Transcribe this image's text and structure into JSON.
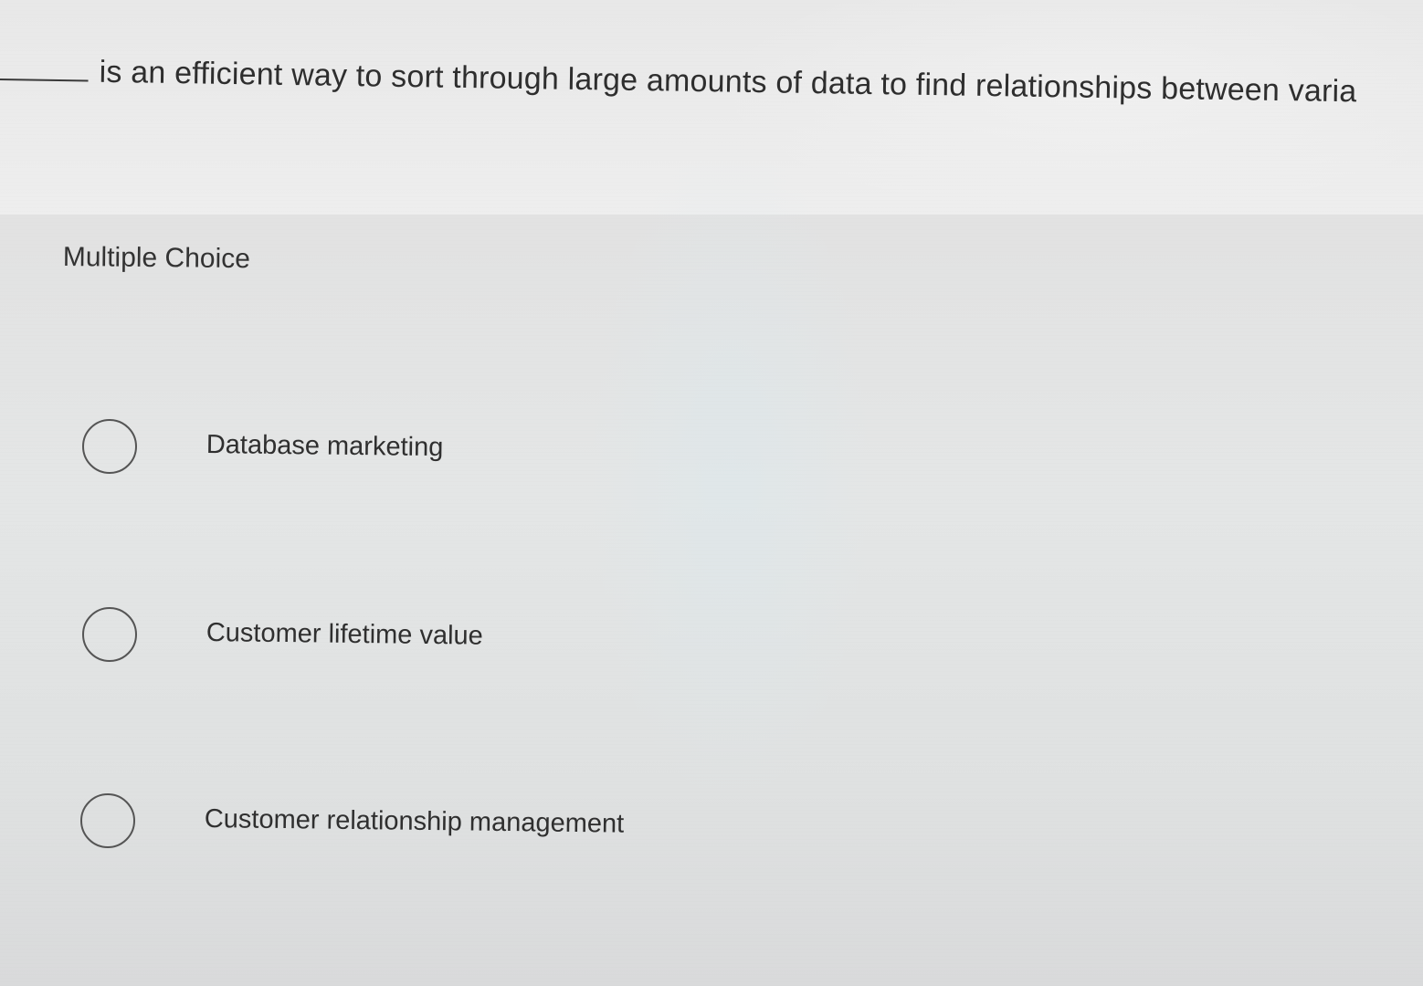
{
  "question": {
    "text": "is an efficient way to sort through large amounts of data to find relationships between varia"
  },
  "question_type": "Multiple Choice",
  "options": [
    {
      "label": "Database marketing",
      "selected": false
    },
    {
      "label": "Customer lifetime value",
      "selected": false
    },
    {
      "label": "Customer relationship management",
      "selected": false
    }
  ]
}
